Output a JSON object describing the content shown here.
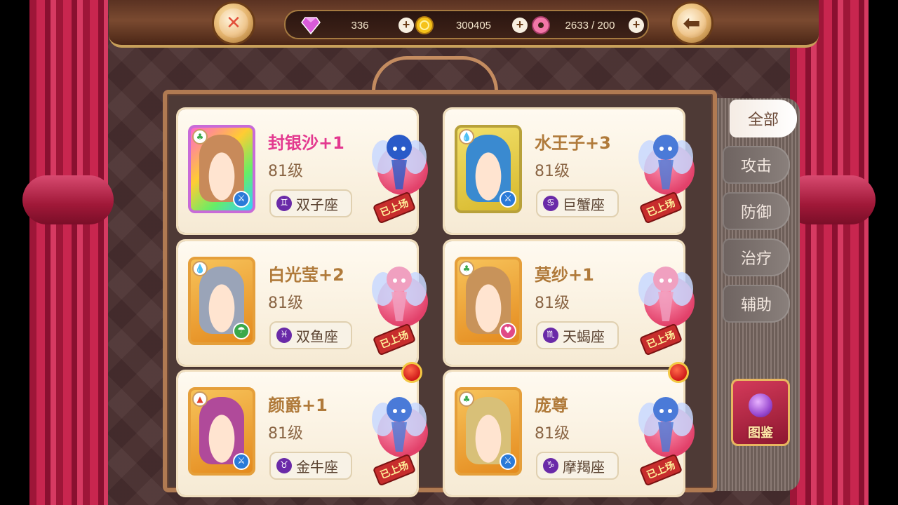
{
  "resources": [
    {
      "icon": "gem-icon",
      "value": "336"
    },
    {
      "icon": "gold-coin-icon",
      "value": "300405"
    },
    {
      "icon": "donut-icon",
      "value": "2633 / 200"
    }
  ],
  "tabs": [
    {
      "label": "全部",
      "active": true
    },
    {
      "label": "攻击",
      "active": false
    },
    {
      "label": "防御",
      "active": false
    },
    {
      "label": "治疗",
      "active": false
    },
    {
      "label": "辅助",
      "active": false
    }
  ],
  "atlas_label": "图鉴",
  "deployed_label": "已上场",
  "cards": [
    {
      "name": "封银沙+1",
      "level": "81级",
      "zodiac": "双子座",
      "zodiac_symbol": "♊",
      "name_color": "pink",
      "element": "wood",
      "role": "attack",
      "portrait": "rainbow",
      "alert": false
    },
    {
      "name": "水王子+3",
      "level": "81级",
      "zodiac": "巨蟹座",
      "zodiac_symbol": "♋",
      "name_color": "gold",
      "element": "water",
      "role": "attack",
      "portrait": "gold",
      "alert": false
    },
    {
      "name": "白光莹+2",
      "level": "81级",
      "zodiac": "双鱼座",
      "zodiac_symbol": "♓",
      "name_color": "gold",
      "element": "water",
      "role": "support",
      "portrait": "orange",
      "alert": false
    },
    {
      "name": "莫纱+1",
      "level": "81级",
      "zodiac": "天蝎座",
      "zodiac_symbol": "♏",
      "name_color": "gold",
      "element": "wood",
      "role": "heal",
      "portrait": "orange",
      "alert": false
    },
    {
      "name": "颜爵+1",
      "level": "81级",
      "zodiac": "金牛座",
      "zodiac_symbol": "♉",
      "name_color": "gold",
      "element": "fire",
      "role": "attack",
      "portrait": "orange",
      "alert": true
    },
    {
      "name": "庞尊",
      "level": "81级",
      "zodiac": "摩羯座",
      "zodiac_symbol": "♑",
      "name_color": "gold",
      "element": "wood",
      "role": "attack",
      "portrait": "orange",
      "alert": true
    }
  ]
}
